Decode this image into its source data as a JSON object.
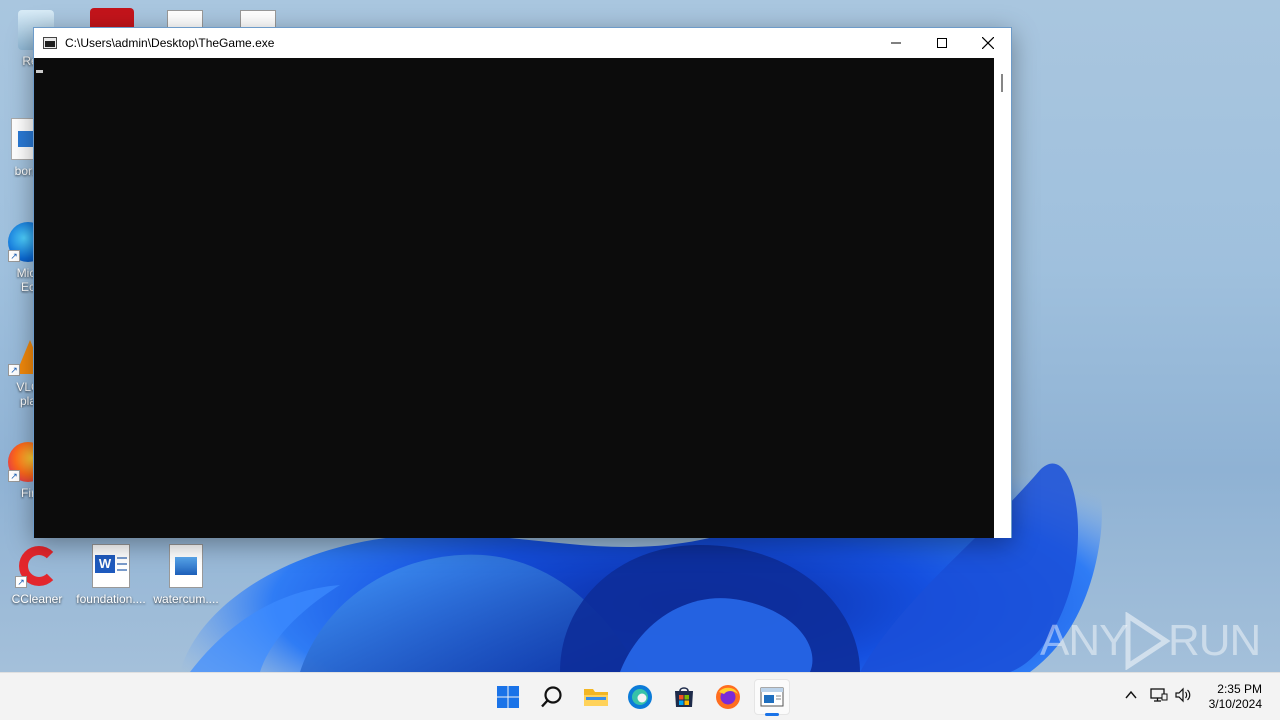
{
  "window": {
    "title": "C:\\Users\\admin\\Desktop\\TheGame.exe",
    "minimize_icon": "minimize-icon",
    "maximize_icon": "maximize-icon",
    "close_icon": "close-icon",
    "console_bg": "#0c0c0c"
  },
  "desktop": {
    "icons": [
      {
        "label": "Recy",
        "icon": "recycle-bin-icon"
      },
      {
        "label": "bornj",
        "icon": "image-file-icon"
      },
      {
        "label": "Micr",
        "label2": "Ec",
        "icon": "edge-icon"
      },
      {
        "label": "VLC",
        "label2": "pla",
        "icon": "vlc-icon"
      },
      {
        "label": "Fir",
        "icon": "firefox-icon"
      },
      {
        "label": "CCleaner",
        "icon": "ccleaner-icon"
      },
      {
        "label": "foundation....",
        "icon": "word-document-icon"
      },
      {
        "label": "watercum....",
        "icon": "image-file-icon"
      }
    ],
    "top_partial_icons": [
      "acrobat-icon",
      "word-document-icon",
      "word-document-icon"
    ]
  },
  "taskbar": {
    "items": [
      "start-icon",
      "search-icon",
      "file-explorer-icon",
      "edge-icon",
      "store-icon",
      "firefox-icon",
      "console-app-icon"
    ],
    "tray": {
      "chevron_icon": "chevron-up-icon",
      "network_icon": "network-icon",
      "volume_icon": "volume-icon",
      "time": "2:35 PM",
      "date": "3/10/2024"
    }
  },
  "watermark": {
    "left": "ANY",
    "right": "RUN"
  }
}
